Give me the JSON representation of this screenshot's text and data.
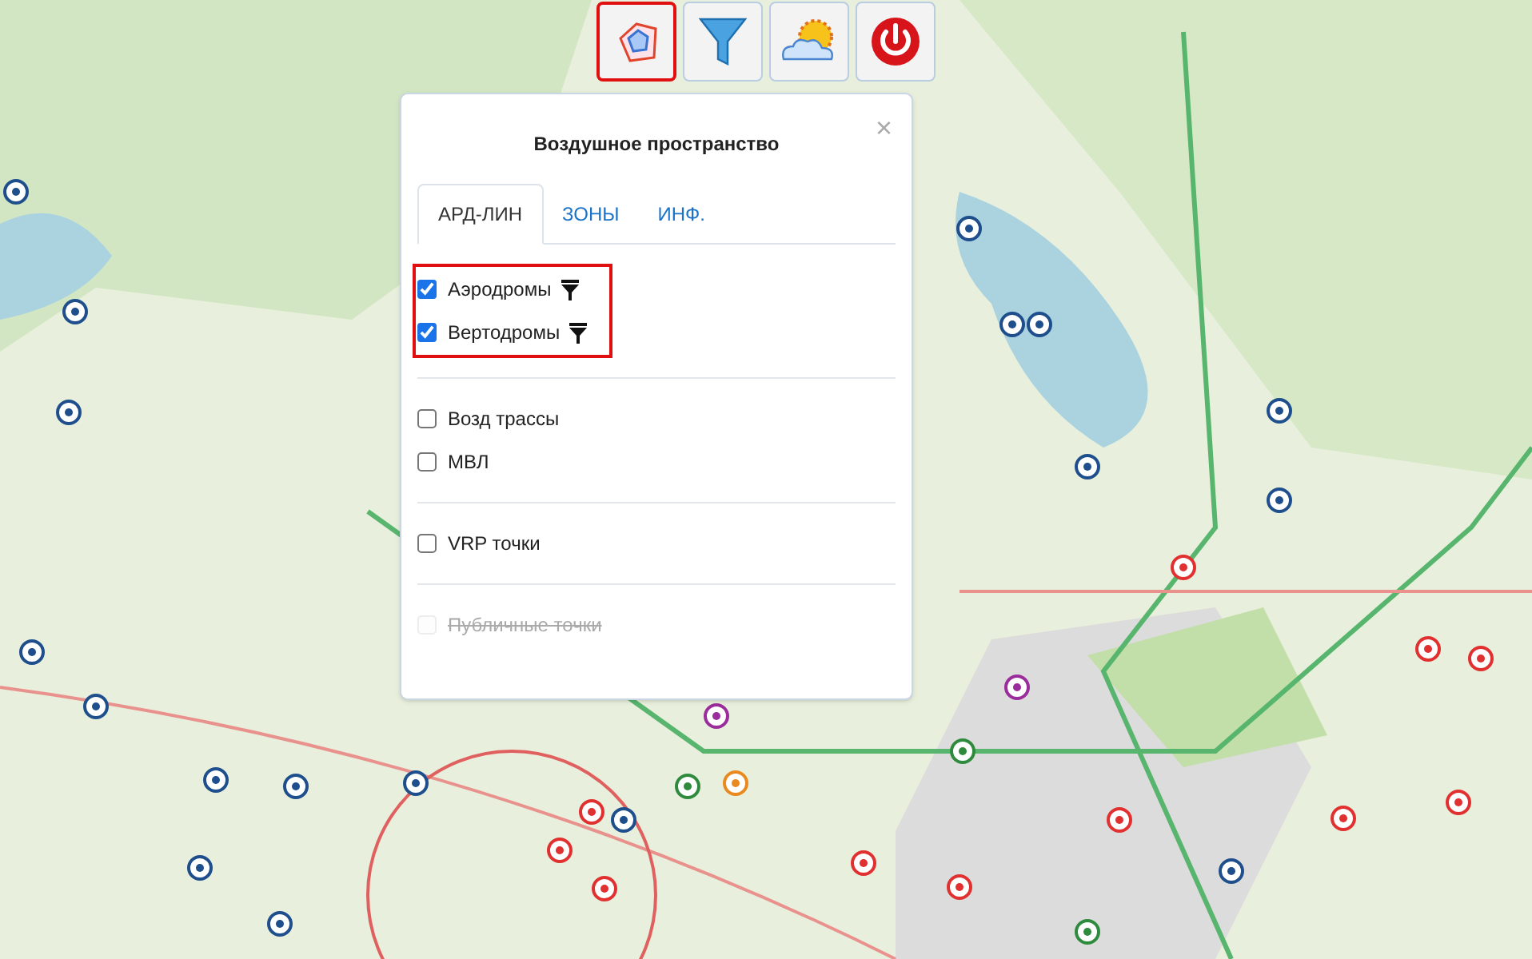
{
  "toolbar": [
    {
      "kind": "airspace",
      "selected": true
    },
    {
      "kind": "filter",
      "selected": false
    },
    {
      "kind": "weather",
      "selected": false
    },
    {
      "kind": "power",
      "selected": false
    }
  ],
  "panel": {
    "title": "Воздушное пространство",
    "close": "×",
    "tabs": [
      {
        "label": "АРД-ЛИН",
        "selected": true
      },
      {
        "label": "ЗОНЫ",
        "selected": false
      },
      {
        "label": "ИНФ.",
        "selected": false
      }
    ],
    "groups": [
      {
        "highlighted": true,
        "items": [
          {
            "label": "Аэродромы",
            "checked": true,
            "disabled": false,
            "filter": true
          },
          {
            "label": "Вертодромы",
            "checked": true,
            "disabled": false,
            "filter": true
          }
        ]
      },
      {
        "highlighted": false,
        "items": [
          {
            "label": "Возд трассы",
            "checked": false,
            "disabled": false,
            "filter": false
          },
          {
            "label": "МВЛ",
            "checked": false,
            "disabled": false,
            "filter": false
          }
        ]
      },
      {
        "highlighted": false,
        "items": [
          {
            "label": "VRP точки",
            "checked": false,
            "disabled": false,
            "filter": false
          }
        ]
      },
      {
        "highlighted": false,
        "items": [
          {
            "label": "Публичные точки",
            "checked": false,
            "disabled": true,
            "filter": false
          }
        ]
      }
    ]
  }
}
